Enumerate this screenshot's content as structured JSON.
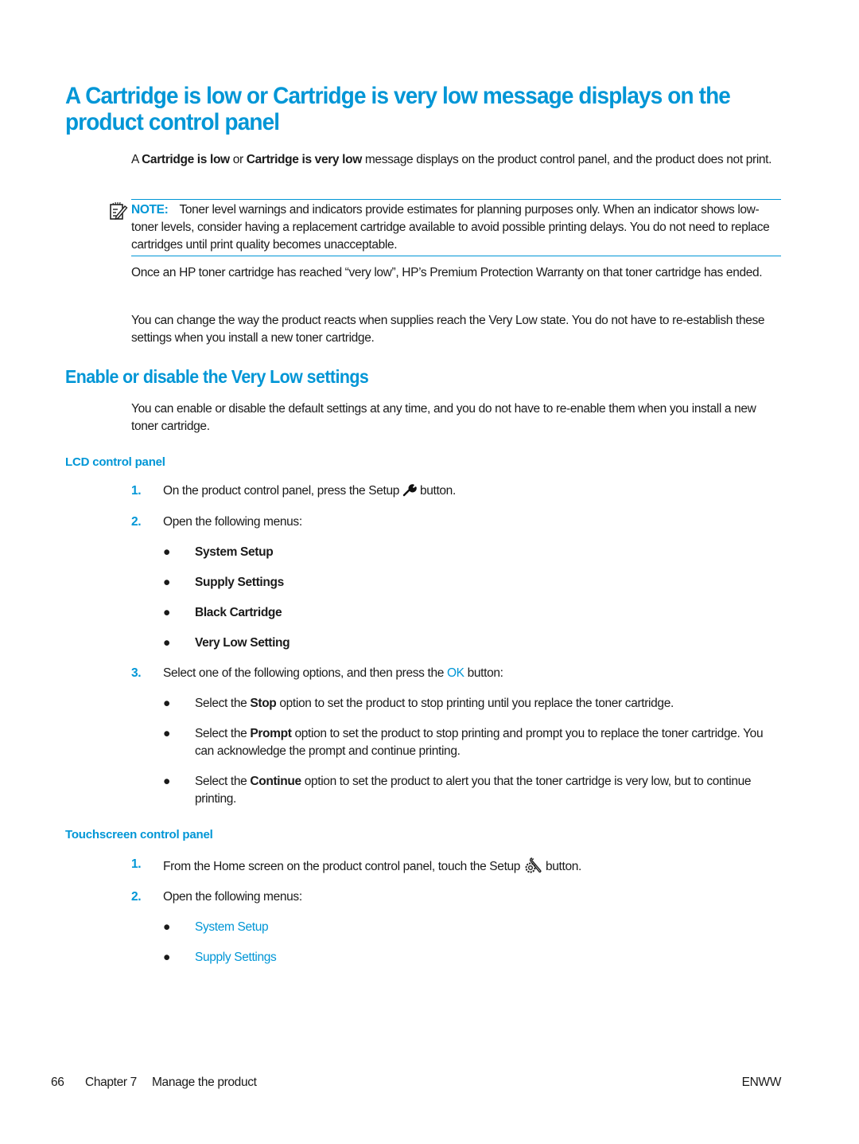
{
  "page": {
    "title": "A Cartridge is low or Cartridge is very low message displays on the product control panel",
    "intro": {
      "prefix": "A ",
      "bold1": "Cartridge is low",
      "middle": " or ",
      "bold2": "Cartridge is very low",
      "suffix": " message displays on the product control panel, and the product does not print."
    },
    "note": {
      "icon": "note-pencil-icon",
      "label": "NOTE:",
      "text": "Toner level warnings and indicators provide estimates for planning purposes only. When an indicator shows low-toner levels, consider having a replacement cartridge available to avoid possible printing delays. You do not need to replace cartridges until print quality becomes unacceptable."
    },
    "para_warranty": "Once an HP toner cartridge has reached “very low”, HP’s Premium Protection Warranty on that toner cartridge has ended.",
    "para_change": "You can change the way the product reacts when supplies reach the Very Low state. You do not have to re-establish these settings when you install a new toner cartridge.",
    "section": {
      "title": "Enable or disable the Very Low settings",
      "intro": "You can enable or disable the default settings at any time, and you do not have to re-enable them when you install a new toner cartridge."
    },
    "lcd": {
      "title": "LCD control panel",
      "steps": [
        {
          "num": "1.",
          "before": "On the product control panel, press the Setup ",
          "icon": "wrench-icon",
          "after": " button."
        },
        {
          "num": "2.",
          "text": "Open the following menus:"
        },
        {
          "num": "3.",
          "before": "Select one of the following options, and then press the ",
          "link": "OK",
          "after": " button:"
        }
      ],
      "menus": [
        "System Setup",
        "Supply Settings",
        "Black Cartridge",
        "Very Low Setting"
      ],
      "options": [
        {
          "before": "Select the ",
          "bold": "Stop",
          "after": " option to set the product to stop printing until you replace the toner cartridge."
        },
        {
          "before": "Select the ",
          "bold": "Prompt",
          "after": " option to set the product to stop printing and prompt you to replace the toner cartridge. You can acknowledge the prompt and continue printing."
        },
        {
          "before": "Select the ",
          "bold": "Continue",
          "after": " option to set the product to alert you that the toner cartridge is very low, but to continue printing."
        }
      ]
    },
    "touch": {
      "title": "Touchscreen control panel",
      "steps": [
        {
          "num": "1.",
          "before": "From the Home screen on the product control panel, touch the Setup ",
          "icon": "setup-gear-wrench-icon",
          "after": " button."
        },
        {
          "num": "2.",
          "text": "Open the following menus:"
        }
      ],
      "menus": [
        "System Setup",
        "Supply Settings"
      ]
    },
    "bullet_glyph": "●",
    "footer": {
      "page_number": "66",
      "chapter": "Chapter 7",
      "chapter_title": "Manage the product",
      "code": "ENWW"
    },
    "colors": {
      "accent": "#0096d6",
      "text": "#1a1a1a"
    }
  }
}
